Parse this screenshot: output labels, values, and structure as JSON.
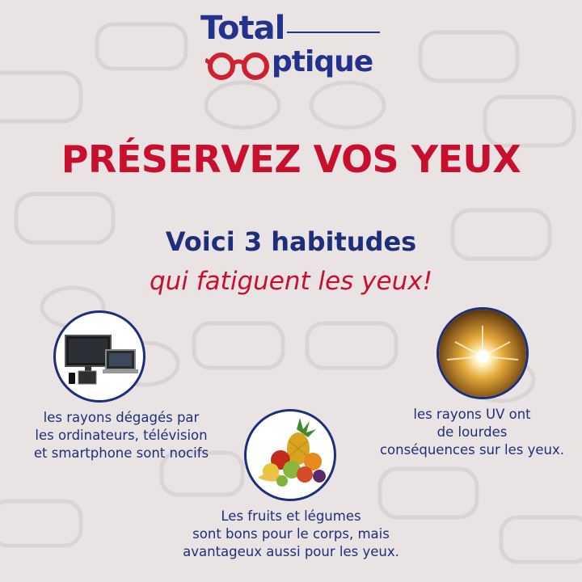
{
  "logo": {
    "line1": "Total",
    "line2_main": "ptique",
    "line2_end": ""
  },
  "headline": "PRÉSERVEZ VOS YEUX",
  "subtitle": {
    "line1": "Voici 3 habitudes",
    "line2": "qui fatiguent les yeux!"
  },
  "items": [
    {
      "icon": "screens-icon",
      "lines": [
        "les rayons dégagés par",
        "les ordinateurs, télévision",
        "et smartphone sont nocifs"
      ]
    },
    {
      "icon": "sun-rays-icon",
      "lines": [
        "les rayons UV ont",
        "de lourdes",
        "conséquences sur les yeux."
      ]
    },
    {
      "icon": "fruits-vegetables-icon",
      "lines": [
        "Les fruits et légumes",
        "sont bons pour le corps, mais",
        "avantageux aussi pour les yeux."
      ]
    }
  ],
  "colors": {
    "navy": "#1d2f7a",
    "red": "#c8102e",
    "background": "#e9e4e3"
  }
}
